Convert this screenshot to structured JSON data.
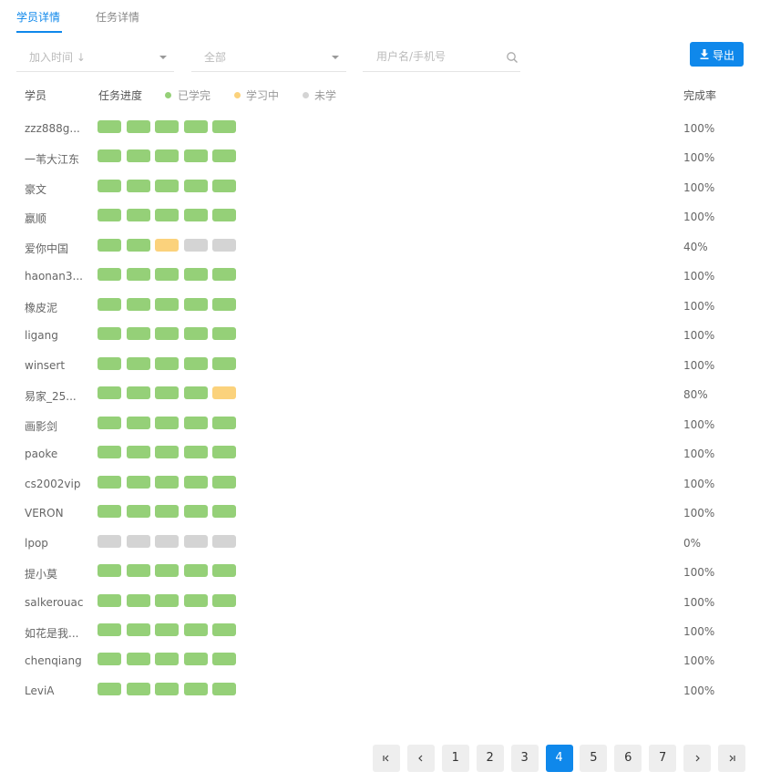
{
  "tabs": [
    {
      "label": "学员详情",
      "active": true
    },
    {
      "label": "任务详情",
      "active": false
    }
  ],
  "filters": {
    "sort_value": "加入时间 ↓",
    "status_value": "全部",
    "search_placeholder": "用户名/手机号"
  },
  "export_label": "导出",
  "table": {
    "headers": {
      "student": "学员",
      "progress": "任务进度",
      "rate": "完成率"
    },
    "legend": [
      {
        "label": "已学完",
        "color": "#95d078"
      },
      {
        "label": "学习中",
        "color": "#fbd27c"
      },
      {
        "label": "未学",
        "color": "#d4d4d4"
      }
    ],
    "status_colors": {
      "done": "#95d078",
      "learning": "#fbd27c",
      "not": "#d4d4d4"
    },
    "rows": [
      {
        "name": "zzz888g...",
        "progress": [
          "done",
          "done",
          "done",
          "done",
          "done"
        ],
        "rate": "100%"
      },
      {
        "name": "一苇大江东",
        "progress": [
          "done",
          "done",
          "done",
          "done",
          "done"
        ],
        "rate": "100%"
      },
      {
        "name": "豪文",
        "progress": [
          "done",
          "done",
          "done",
          "done",
          "done"
        ],
        "rate": "100%"
      },
      {
        "name": "嬴顺",
        "progress": [
          "done",
          "done",
          "done",
          "done",
          "done"
        ],
        "rate": "100%"
      },
      {
        "name": "爱你中国",
        "progress": [
          "done",
          "done",
          "learning",
          "not",
          "not"
        ],
        "rate": "40%"
      },
      {
        "name": "haonan3...",
        "progress": [
          "done",
          "done",
          "done",
          "done",
          "done"
        ],
        "rate": "100%"
      },
      {
        "name": "橡皮泥",
        "progress": [
          "done",
          "done",
          "done",
          "done",
          "done"
        ],
        "rate": "100%"
      },
      {
        "name": "ligang",
        "progress": [
          "done",
          "done",
          "done",
          "done",
          "done"
        ],
        "rate": "100%"
      },
      {
        "name": "winsert",
        "progress": [
          "done",
          "done",
          "done",
          "done",
          "done"
        ],
        "rate": "100%"
      },
      {
        "name": "易家_25...",
        "progress": [
          "done",
          "done",
          "done",
          "done",
          "learning"
        ],
        "rate": "80%"
      },
      {
        "name": "画影剑",
        "progress": [
          "done",
          "done",
          "done",
          "done",
          "done"
        ],
        "rate": "100%"
      },
      {
        "name": "paoke",
        "progress": [
          "done",
          "done",
          "done",
          "done",
          "done"
        ],
        "rate": "100%"
      },
      {
        "name": "cs2002vip",
        "progress": [
          "done",
          "done",
          "done",
          "done",
          "done"
        ],
        "rate": "100%"
      },
      {
        "name": "VERON",
        "progress": [
          "done",
          "done",
          "done",
          "done",
          "done"
        ],
        "rate": "100%"
      },
      {
        "name": "lpop",
        "progress": [
          "not",
          "not",
          "not",
          "not",
          "not"
        ],
        "rate": "0%"
      },
      {
        "name": "提小莫",
        "progress": [
          "done",
          "done",
          "done",
          "done",
          "done"
        ],
        "rate": "100%"
      },
      {
        "name": "salkerouac",
        "progress": [
          "done",
          "done",
          "done",
          "done",
          "done"
        ],
        "rate": "100%"
      },
      {
        "name": "如花是我...",
        "progress": [
          "done",
          "done",
          "done",
          "done",
          "done"
        ],
        "rate": "100%"
      },
      {
        "name": "chenqiang",
        "progress": [
          "done",
          "done",
          "done",
          "done",
          "done"
        ],
        "rate": "100%"
      },
      {
        "name": "LeviA",
        "progress": [
          "done",
          "done",
          "done",
          "done",
          "done"
        ],
        "rate": "100%"
      }
    ]
  },
  "pagination": {
    "pages": [
      "1",
      "2",
      "3",
      "4",
      "5",
      "6",
      "7"
    ],
    "current": "4",
    "controls": {
      "first": "first-page-icon",
      "prev": "prev-page-icon",
      "next": "next-page-icon",
      "last": "last-page-icon"
    }
  },
  "colors": {
    "accent": "#0f88eb"
  }
}
